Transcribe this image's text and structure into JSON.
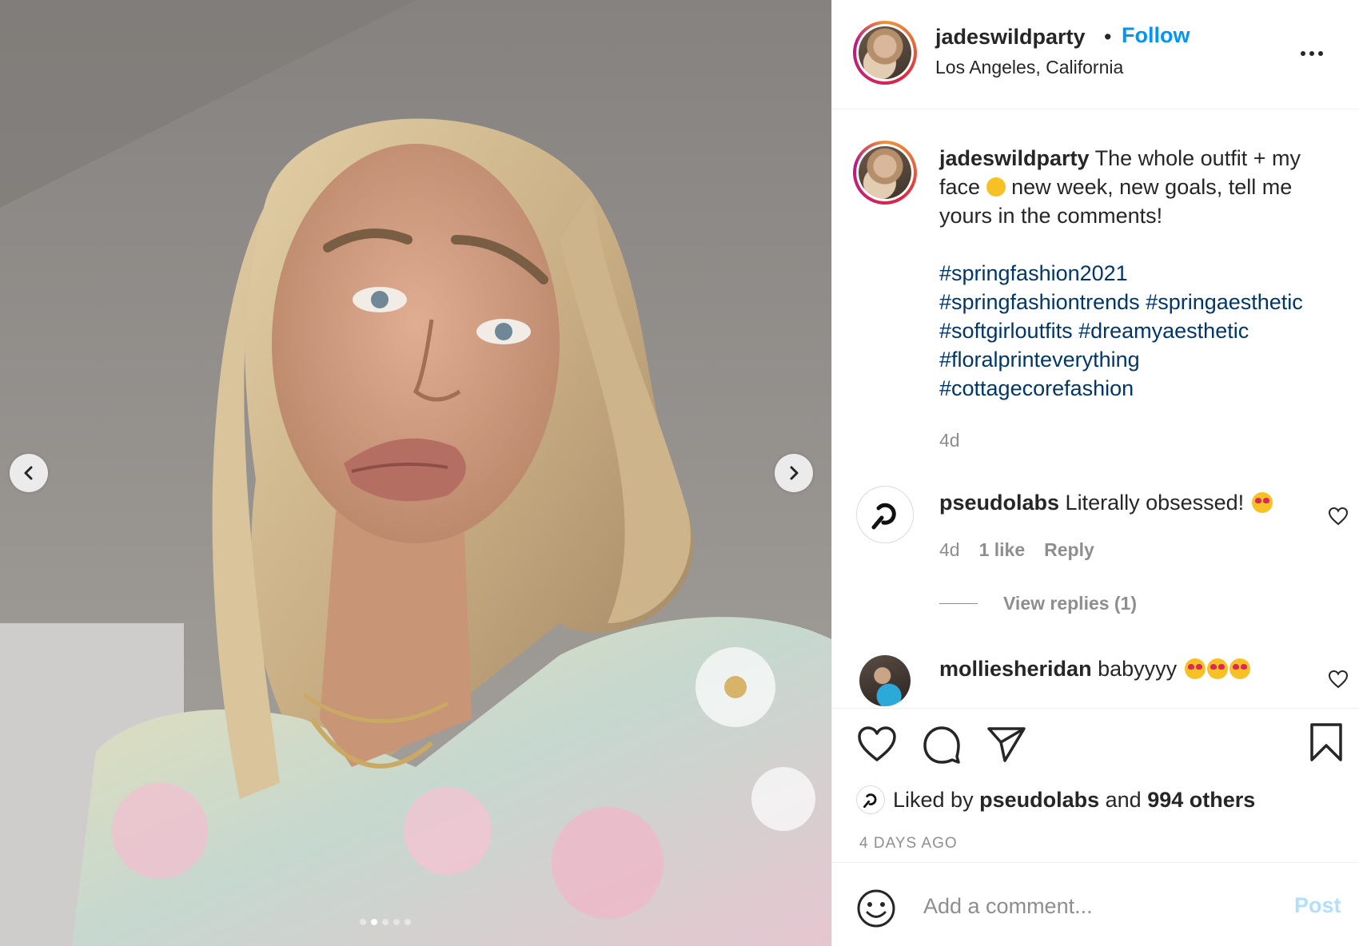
{
  "post": {
    "username": "jadeswildparty",
    "separator": "•",
    "follow_label": "Follow",
    "location": "Los Angeles, California",
    "caption_text_1": "The whole outfit + my face",
    "caption_text_2": "new week, new goals, tell me yours in the comments!",
    "hashtags": [
      "#springfashion2021",
      "#springfashiontrends",
      "#springaesthetic",
      "#softgirloutfits",
      "#dreamyaesthetic",
      "#floralprinteverything",
      "#cottagecorefashion"
    ],
    "caption_time": "4d"
  },
  "comments": [
    {
      "username": "pseudolabs",
      "text": "Literally obsessed!",
      "time": "4d",
      "likes": "1 like",
      "reply_label": "Reply",
      "view_replies": "View replies (1)"
    },
    {
      "username": "molliesheridan",
      "text": "babyyyy"
    }
  ],
  "actions": {
    "liked_by_prefix": "Liked by",
    "liked_by_user": "pseudolabs",
    "liked_by_and": "and",
    "liked_by_others": "994 others",
    "date": "4 DAYS AGO"
  },
  "composer": {
    "placeholder": "Add a comment...",
    "post_label": "Post"
  },
  "icons": {
    "prev": "chevron-left-icon",
    "next": "chevron-right-icon",
    "more": "more-options-icon",
    "like": "heart-icon",
    "comment": "comment-bubble-icon",
    "share": "paper-plane-icon",
    "save": "bookmark-icon",
    "emoji": "smiley-icon"
  },
  "colors": {
    "link_blue": "#0095f6",
    "hashtag": "#00376b",
    "muted": "#8e8e8e",
    "post_disabled": "#b2dffc"
  }
}
